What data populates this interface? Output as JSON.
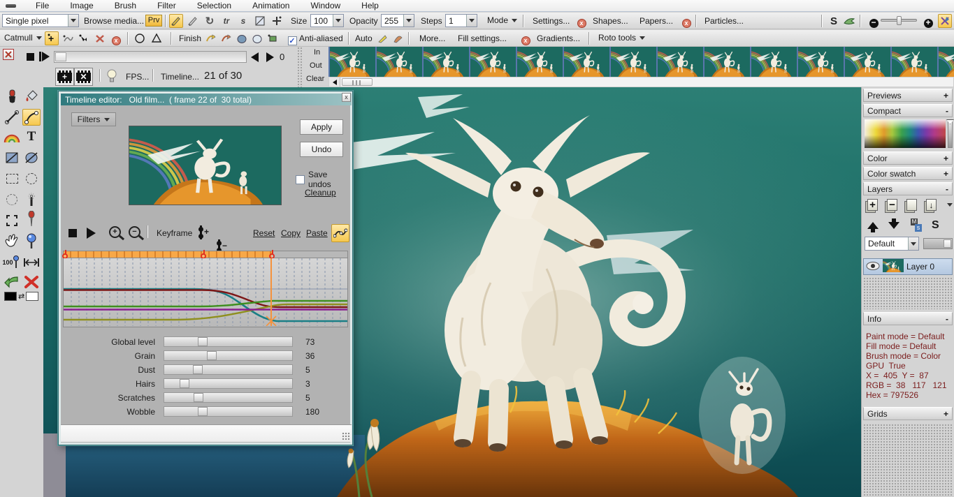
{
  "menu": {
    "items": [
      "File",
      "Image",
      "Brush",
      "Filter",
      "Selection",
      "Animation",
      "Window",
      "Help"
    ]
  },
  "toolbar1": {
    "brush_type": "Single pixel",
    "browse_media": "Browse media...",
    "prv": "Prv",
    "size_label": "Size",
    "size_value": "100",
    "opacity_label": "Opacity",
    "opacity_value": "255",
    "steps_label": "Steps",
    "steps_value": "1",
    "mode_label": "Mode",
    "settings": "Settings...",
    "shapes": "Shapes...",
    "papers": "Papers...",
    "particles": "Particles..."
  },
  "toolbar2": {
    "spline_type": "Catmull",
    "finish_label": "Finish",
    "antialiased_label": "Anti-aliased",
    "auto_label": "Auto",
    "more": "More...",
    "fill_settings": "Fill settings...",
    "gradients": "Gradients...",
    "roto_tools": "Roto tools"
  },
  "transport": {
    "frame_offset": "0",
    "in_label": "In",
    "out_label": "Out",
    "clear_label": "Clear",
    "fps": "FPS...",
    "timeline": "Timeline...",
    "frame_counter": "21 of 30"
  },
  "icons": {
    "refresh_glyph": "↻",
    "tr_glyph": "tr",
    "smear_glyph": "s",
    "check_glyph": "✓",
    "x_glyph": "x",
    "text_tool_glyph": "T",
    "zoom100_glyph": "100",
    "s_tool_glyph": "S",
    "swap_glyph": "⇄",
    "plus_glyph": "+",
    "minus_glyph": "−",
    "arrow_left_glyph": "◄",
    "m_badge": "M",
    "s_badge": "s"
  },
  "dialog": {
    "title_left": "Timeline editor:",
    "title_right": "Old film...  ( frame 22 of  30 total)",
    "filters_label": "Filters",
    "apply": "Apply",
    "undo": "Undo",
    "save_undos": "Save undos",
    "cleanup": "Cleanup",
    "keyframe_label": "Keyframe",
    "reset": "Reset",
    "copy": "Copy",
    "paste": "Paste",
    "sliders": [
      {
        "label": "Global level",
        "value": "73",
        "pct": 30
      },
      {
        "label": "Grain",
        "value": "36",
        "pct": 37
      },
      {
        "label": "Dust",
        "value": "5",
        "pct": 26
      },
      {
        "label": "Hairs",
        "value": "3",
        "pct": 16
      },
      {
        "label": "Scratches",
        "value": "5",
        "pct": 27
      },
      {
        "label": "Wobble",
        "value": "180",
        "pct": 30
      }
    ],
    "curve_colors": {
      "teal": "#1a7f86",
      "dark_red": "#7d1717",
      "green": "#3f8f1f",
      "olive": "#8f8f1f",
      "purple": "#8a1f8f",
      "marker_orange": "#f5923c"
    }
  },
  "right_panel": {
    "headers": [
      {
        "label": "Previews",
        "toggle": "+"
      },
      {
        "label": "Compact",
        "toggle": "-"
      },
      {
        "label": "Color",
        "toggle": "+"
      },
      {
        "label": "Color swatch",
        "toggle": "+"
      },
      {
        "label": "Layers",
        "toggle": "-"
      },
      {
        "label": "Info",
        "toggle": "-"
      },
      {
        "label": "Grids",
        "toggle": "+"
      }
    ],
    "blend_mode": "Default",
    "layer_name": "Layer 0",
    "info_lines": [
      "Paint mode = Default",
      "Fill mode = Default",
      "Brush mode = Color",
      "GPU  True",
      "X =  405  Y =  87",
      "RGB =  38   117   121",
      "Hex = 797526"
    ]
  },
  "filmstrip": {
    "visible_frames": 14
  }
}
